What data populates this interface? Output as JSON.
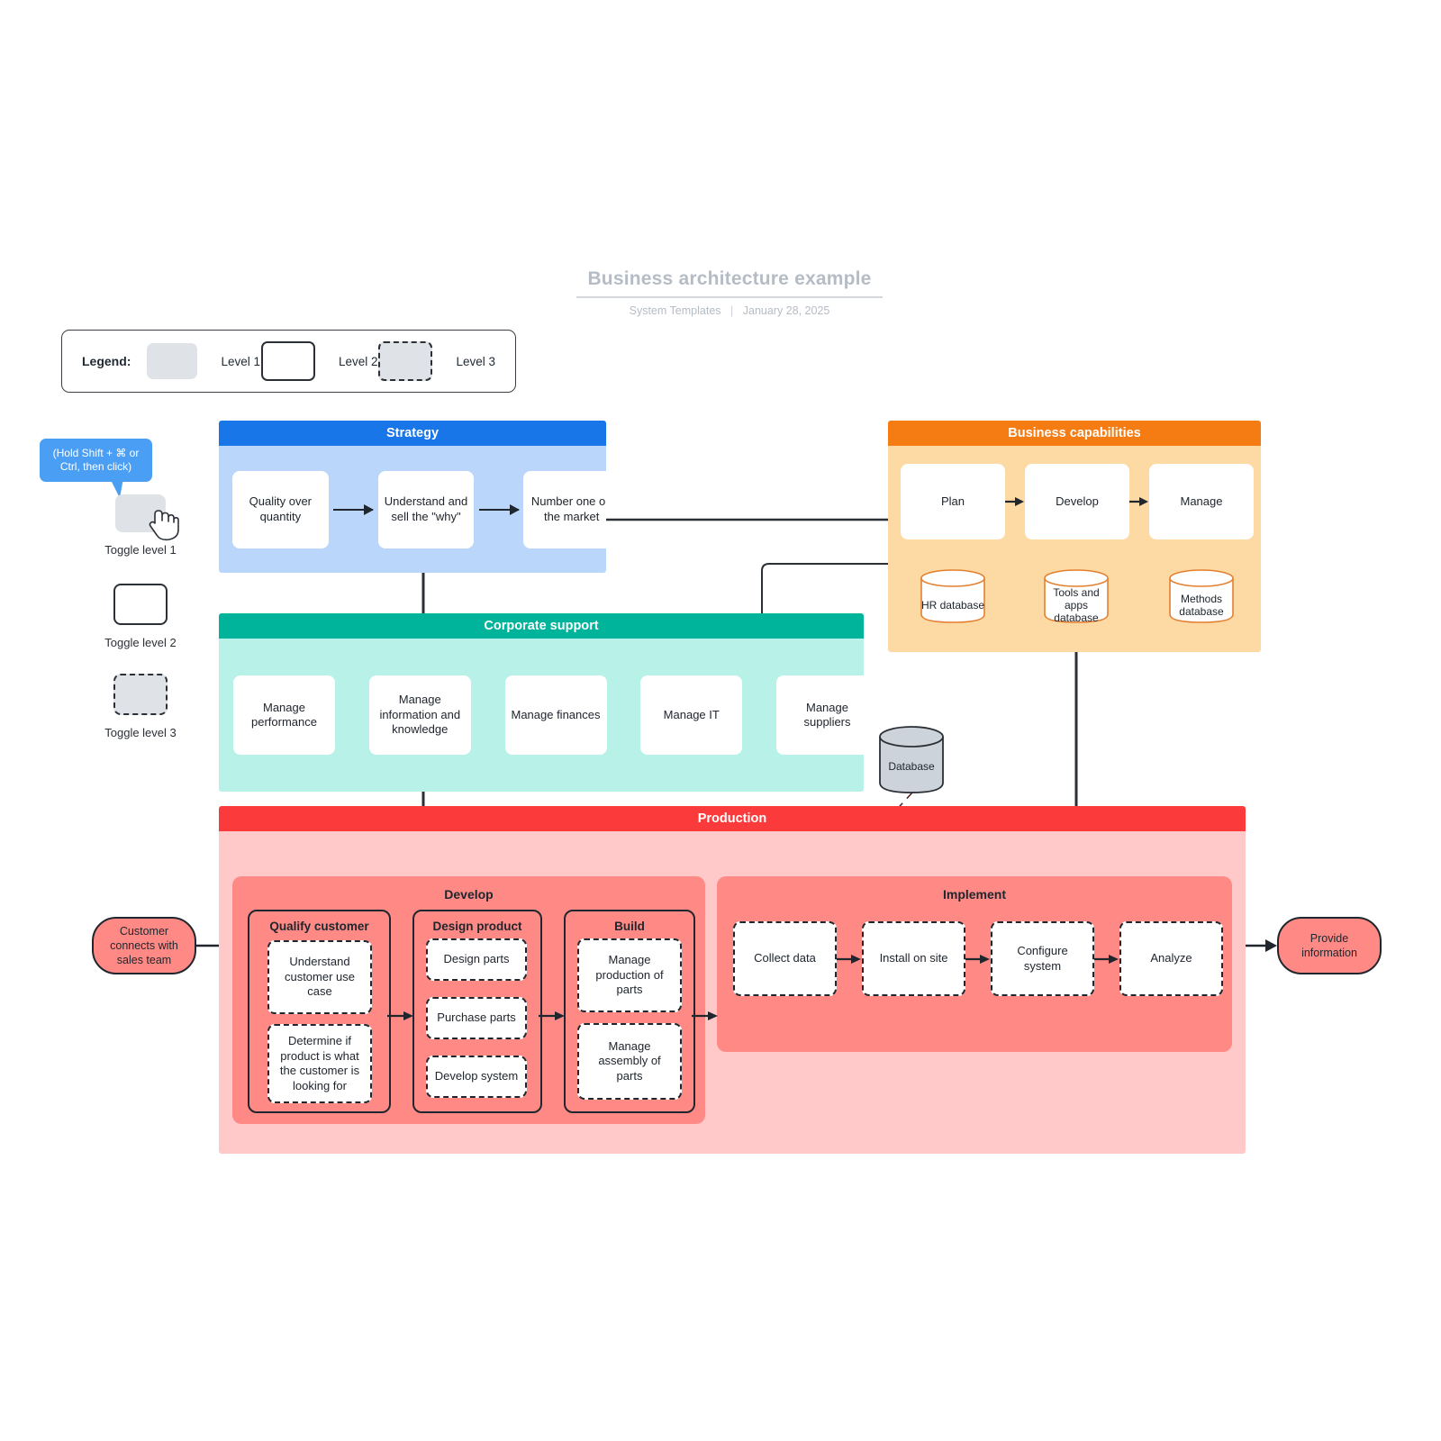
{
  "document": {
    "title": "Business architecture example",
    "author": "System Templates",
    "date": "January 28, 2025",
    "divider": "|"
  },
  "legend": {
    "label": "Legend:",
    "items": [
      {
        "swatch": "level-1-filled",
        "text": "Level 1"
      },
      {
        "swatch": "level-2-outline",
        "text": "Level 2"
      },
      {
        "swatch": "level-3-dashed",
        "text": "Level 3"
      }
    ]
  },
  "toggles": {
    "tooltip": "(Hold Shift + ⌘ or Ctrl, then click)",
    "items": [
      {
        "style": "l1",
        "label": "Toggle level 1"
      },
      {
        "style": "l2",
        "label": "Toggle level 2"
      },
      {
        "style": "l3",
        "label": "Toggle level 3"
      }
    ]
  },
  "panels": {
    "strategy": {
      "title": "Strategy",
      "header_color": "#1976e8",
      "body_color": "#bad6fb",
      "nodes": [
        "Quality over quantity",
        "Understand and sell the \"why\"",
        "Number one on the market"
      ]
    },
    "business_capabilities": {
      "title": "Business capabilities",
      "header_color": "#f57c12",
      "body_color": "#fdd9a4",
      "nodes": [
        "Plan",
        "Develop",
        "Manage"
      ],
      "databases": [
        "HR database",
        "Tools and apps database",
        "Methods database"
      ]
    },
    "corporate_support": {
      "title": "Corporate support",
      "header_color": "#00b39b",
      "body_color": "#b8f1e7",
      "nodes": [
        "Manage performance",
        "Manage information and knowledge",
        "Manage finances",
        "Manage IT",
        "Manage suppliers"
      ]
    },
    "production": {
      "title": "Production",
      "header_color": "#fb3b3b",
      "body_color": "#ffc9c9",
      "group_color": "#ff8a85",
      "groups": [
        {
          "title": "Develop",
          "subgroups": [
            {
              "title": "Qualify customer",
              "nodes": [
                "Understand customer use case",
                "Determine if product is what the customer is looking for"
              ]
            },
            {
              "title": "Design product",
              "nodes": [
                "Design parts",
                "Purchase parts",
                "Develop system"
              ]
            },
            {
              "title": "Build",
              "nodes": [
                "Manage production of parts",
                "Manage assembly of parts"
              ]
            }
          ]
        },
        {
          "title": "Implement",
          "nodes": [
            "Collect data",
            "Install on site",
            "Configure system",
            "Analyze"
          ]
        }
      ]
    }
  },
  "shapes": {
    "database_standalone": "Database",
    "start_pill": "Customer connects with sales team",
    "end_pill": "Provide information"
  }
}
